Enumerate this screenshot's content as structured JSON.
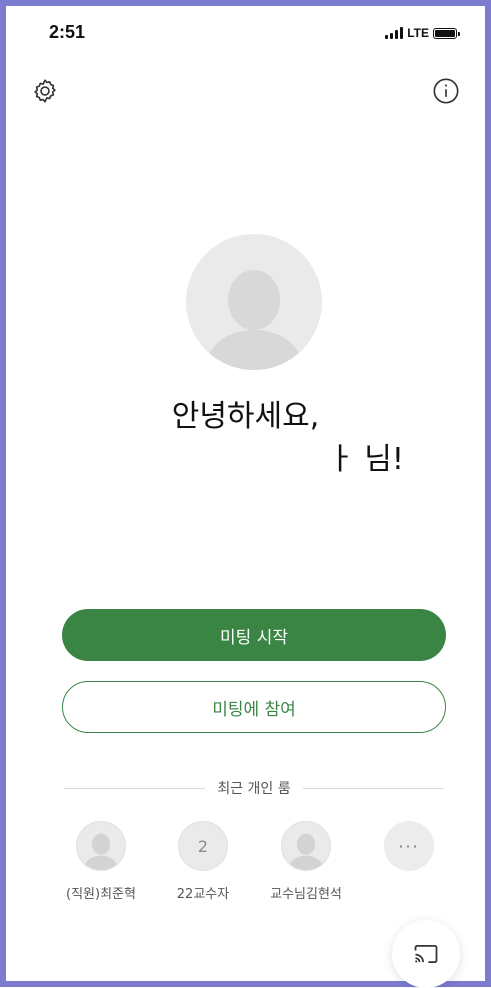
{
  "status_bar": {
    "time": "2:51",
    "network": "LTE"
  },
  "header": {
    "settings_icon": "gear-icon",
    "info_icon": "info-icon"
  },
  "profile": {
    "avatar_icon": "person-avatar"
  },
  "greeting": {
    "line1": "안녕하세요,",
    "line2": "ㅏ 님!"
  },
  "actions": {
    "start_meeting": "미팅 시작",
    "join_meeting": "미팅에 참여"
  },
  "recent": {
    "title": "최근 개인 룸",
    "rooms": [
      {
        "name": "(직원)최준혁",
        "type": "photo"
      },
      {
        "name": "22교수자",
        "type": "number",
        "initial": "2"
      },
      {
        "name": "교수님김현석",
        "type": "photo"
      },
      {
        "name": "",
        "type": "more",
        "more_label": "···"
      }
    ]
  },
  "cast": {
    "icon": "cast-icon"
  },
  "colors": {
    "primary": "#3a8544",
    "frame": "#7b7bd0"
  }
}
